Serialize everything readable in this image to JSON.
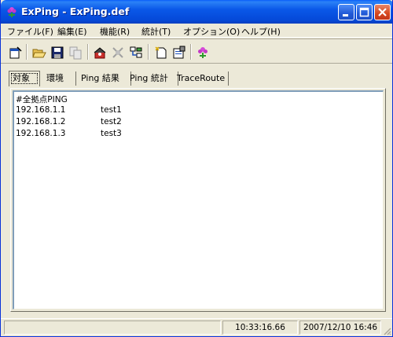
{
  "window": {
    "title": "ExPing - ExPing.def",
    "title_color": "#ffffff",
    "titlebar_color": "#0a58e8",
    "close_color": "#d6471d"
  },
  "menu": {
    "items": [
      {
        "label": "ファイル(F)"
      },
      {
        "label": "編集(E)"
      },
      {
        "label": "機能(R)"
      },
      {
        "label": "統計(T)"
      },
      {
        "label": "オプション(O)"
      },
      {
        "label": "ヘルプ(H)"
      }
    ]
  },
  "toolbar": {
    "buttons": [
      {
        "icon": "edit-target-icon"
      },
      {
        "icon": "open-folder-icon"
      },
      {
        "icon": "save-icon"
      },
      {
        "icon": "copy-disabled-icon"
      },
      {
        "icon": "ping-start-icon"
      },
      {
        "icon": "stop-disabled-icon"
      },
      {
        "icon": "network-icon"
      },
      {
        "icon": "new-file-icon"
      },
      {
        "icon": "properties-icon"
      },
      {
        "icon": "about-flower-icon"
      }
    ]
  },
  "tabs": [
    {
      "label": "対象",
      "active": true
    },
    {
      "label": "環境",
      "active": false
    },
    {
      "label": "Ping 結果",
      "active": false
    },
    {
      "label": "Ping 統計",
      "active": false
    },
    {
      "label": "TraceRoute",
      "active": false
    }
  ],
  "target_list": {
    "header": "#全拠点PING",
    "rows": [
      {
        "ip": "192.168.1.1",
        "name": "test1"
      },
      {
        "ip": "192.168.1.2",
        "name": "test2"
      },
      {
        "ip": "192.168.1.3",
        "name": "test3"
      }
    ]
  },
  "status": {
    "elapsed": "10:33:16.66",
    "datetime": "2007/12/10 16:46"
  }
}
